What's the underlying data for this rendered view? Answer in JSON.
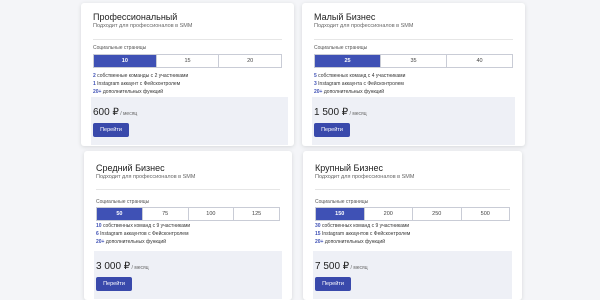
{
  "plans": [
    {
      "title": "Профессиональный",
      "subtitle": "Подходит для профессионалов в SMM",
      "segments_label": "Социальные страницы",
      "segments": [
        "10",
        "15",
        "20"
      ],
      "active": 0,
      "features": [
        {
          "num": "2",
          "text": " собственные команды с 2 участниками"
        },
        {
          "num": "1",
          "text": " Instagram аккаунт с Фейсконтролем"
        },
        {
          "num": "20+",
          "text": " дополнительных функций"
        }
      ],
      "price": "600 ₽",
      "per": " / месяц",
      "button": "Перейти"
    },
    {
      "title": "Малый Бизнес",
      "subtitle": "Подходит для профессионалов в SMM",
      "segments_label": "Социальные страницы",
      "segments": [
        "25",
        "35",
        "40"
      ],
      "active": 0,
      "features": [
        {
          "num": "5",
          "text": " собственных команд с 4 участниками"
        },
        {
          "num": "3",
          "text": " Instagram аккаунта с Фейсконтролем"
        },
        {
          "num": "20+",
          "text": " дополнительных функций"
        }
      ],
      "price": "1 500 ₽",
      "per": " / месяц",
      "button": "Перейти"
    },
    {
      "title": "Средний Бизнес",
      "subtitle": "Подходит для профессионалов в SMM",
      "segments_label": "Социальные страницы",
      "segments": [
        "50",
        "75",
        "100",
        "125"
      ],
      "active": 0,
      "features": [
        {
          "num": "10",
          "text": " собственных команд с 9 участниками"
        },
        {
          "num": "6",
          "text": " Instagram аккаунтов с Фейсконтролем"
        },
        {
          "num": "20+",
          "text": " дополнительных функций"
        }
      ],
      "price": "3 000 ₽",
      "per": " / месяц",
      "button": "Перейти"
    },
    {
      "title": "Крупный Бизнес",
      "subtitle": "Подходит для профессионалов в SMM",
      "segments_label": "Социальные страницы",
      "segments": [
        "150",
        "200",
        "250",
        "500"
      ],
      "active": 0,
      "features": [
        {
          "num": "30",
          "text": " собственных команд с 9 участниками"
        },
        {
          "num": "15",
          "text": " Instagram аккаунтов с Фейсконтролем"
        },
        {
          "num": "20+",
          "text": " дополнительных функций"
        }
      ],
      "price": "7 500 ₽",
      "per": " / месяц",
      "button": "Перейти"
    }
  ],
  "colors": {
    "accent": "#3f51b5",
    "button": "#3949ab",
    "price_bg": "#eef0f6"
  }
}
